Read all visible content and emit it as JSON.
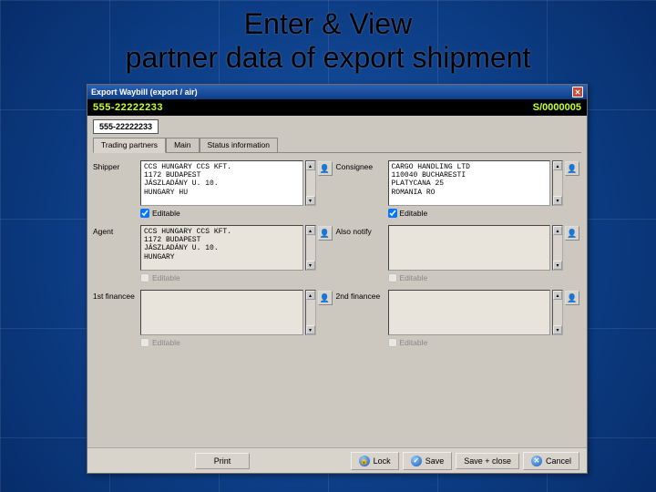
{
  "slide": {
    "title_line1": "Enter & View",
    "title_line2": "partner data of export shipment"
  },
  "window": {
    "title": "Export Waybill (export / air)",
    "hdr_left": "555-22222233",
    "hdr_right": "S/0000005",
    "waybill": "555-22222233",
    "tabs": [
      "Trading partners",
      "Main",
      "Status information"
    ],
    "partners": {
      "shipper": {
        "label": "Shipper",
        "text": "CCS HUNGARY CCS KFT.\n1172 BUDAPEST\nJÁSZLADÁNY U. 10.\nHUNGARY HU",
        "editable": true,
        "editable_label": "Editable"
      },
      "consignee": {
        "label": "Consignee",
        "text": "CARGO HANDLING LTD\n110040 BUCHARESTI\nPLATYCANA 25\nROMANIA RO",
        "editable": true,
        "editable_label": "Editable"
      },
      "agent": {
        "label": "Agent",
        "text": "CCS HUNGARY CCS KFT.\n1172 BUDAPEST\nJÁSZLADÁNY U. 10.\nHUNGARY",
        "editable": false,
        "editable_label": "Editable"
      },
      "alsonotify": {
        "label": "Also notify",
        "text": "",
        "editable": false,
        "editable_label": "Editable"
      },
      "fin1": {
        "label": "1st financee",
        "text": "",
        "editable": false,
        "editable_label": "Editable"
      },
      "fin2": {
        "label": "2nd financee",
        "text": "",
        "editable": false,
        "editable_label": "Editable"
      }
    },
    "buttons": {
      "print": "Print",
      "lock": "Lock",
      "save": "Save",
      "save_close": "Save + close",
      "cancel": "Cancel"
    }
  }
}
